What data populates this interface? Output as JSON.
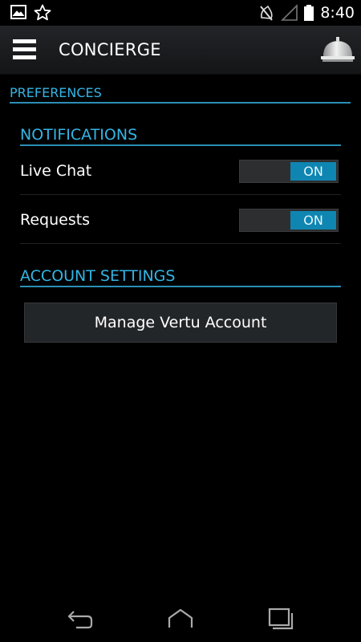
{
  "status_bar": {
    "time": "8:40",
    "icons": [
      "image-icon",
      "star-icon",
      "muted-icon",
      "signal-icon",
      "battery-icon"
    ]
  },
  "action_bar": {
    "title": "CONCIERGE",
    "menu_icon": "menu-icon",
    "bell_icon": "concierge-bell-icon"
  },
  "preferences": {
    "header": "PREFERENCES",
    "notifications": {
      "header": "NOTIFICATIONS",
      "items": [
        {
          "label": "Live Chat",
          "state": "ON"
        },
        {
          "label": "Requests",
          "state": "ON"
        }
      ]
    },
    "account_settings": {
      "header": "ACCOUNT SETTINGS",
      "manage_button": "Manage Vertu Account"
    }
  },
  "nav_bar": {
    "icons": [
      "back-icon",
      "home-icon",
      "recent-apps-icon"
    ]
  },
  "colors": {
    "accent": "#33b5e5",
    "toggle_on": "#0f86b2",
    "background": "#000000"
  }
}
